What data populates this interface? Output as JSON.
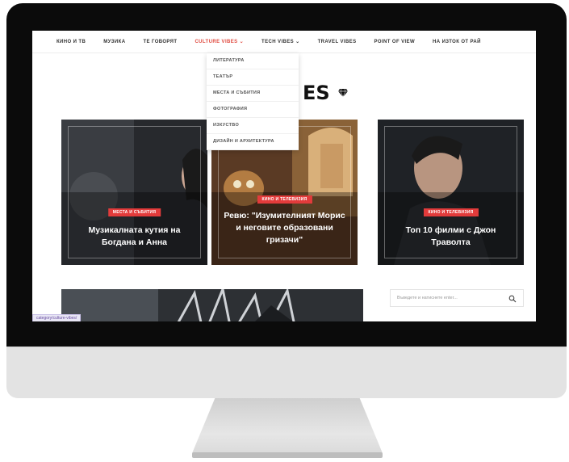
{
  "nav": {
    "items": [
      "КИНО И ТВ",
      "МУЗИКА",
      "ТЕ ГОВОРЯТ",
      "CULTURE VIBES ⌄",
      "TECH VIBES ⌄",
      "TRAVEL VIBES",
      "POINT OF VIEW",
      "НА ИЗТОК ОТ РАЙ"
    ],
    "active_index": 3
  },
  "dropdown": {
    "items": [
      "ЛИТЕРАТУРА",
      "ТЕАТЪР",
      "МЕСТА И СЪБИТИЯ",
      "ФОТОГРАФИЯ",
      "ИЗКУСТВО",
      "ДИЗАЙН И АРХИТЕКТУРА"
    ]
  },
  "logo": {
    "visible_text": "ES"
  },
  "cards": [
    {
      "tag": "МЕСТА И СЪБИТИЯ",
      "title": "Музикалната кутия на Богдана и Анна"
    },
    {
      "tag": "КИНО И ТЕЛЕВИЗИЯ",
      "title": "Ревю: \"Изумителният Морис и неговите образовани гризачи\""
    },
    {
      "tag": "КИНО И ТЕЛЕВИЗИЯ",
      "title": "Топ 10 филми с Джон Траволта"
    }
  ],
  "search": {
    "placeholder": "Въведете и натиснете enter..."
  },
  "status_bar": {
    "url": "category/culture-vibes/"
  },
  "colors": {
    "accent": "#e04a3f",
    "tag_red": "#e23b3b",
    "bezel": "#0b0b0b",
    "chin": "#e3e3e3"
  },
  "icons": {
    "logo": "diamond-icon",
    "search": "search-icon"
  }
}
